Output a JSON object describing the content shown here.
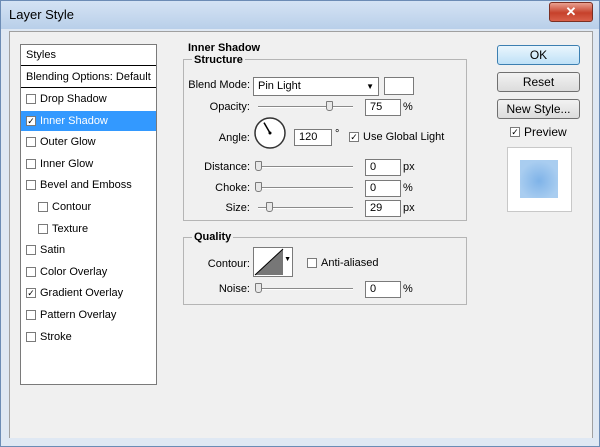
{
  "window": {
    "title": "Layer Style",
    "close_label": "✕"
  },
  "styles_panel": {
    "header": "Styles",
    "blending": "Blending Options: Default",
    "items": [
      {
        "label": "Drop Shadow",
        "checked": false,
        "selected": false,
        "indent": false
      },
      {
        "label": "Inner Shadow",
        "checked": true,
        "selected": true,
        "indent": false
      },
      {
        "label": "Outer Glow",
        "checked": false,
        "selected": false,
        "indent": false
      },
      {
        "label": "Inner Glow",
        "checked": false,
        "selected": false,
        "indent": false
      },
      {
        "label": "Bevel and Emboss",
        "checked": false,
        "selected": false,
        "indent": false
      },
      {
        "label": "Contour",
        "checked": false,
        "selected": false,
        "indent": true
      },
      {
        "label": "Texture",
        "checked": false,
        "selected": false,
        "indent": true
      },
      {
        "label": "Satin",
        "checked": false,
        "selected": false,
        "indent": false
      },
      {
        "label": "Color Overlay",
        "checked": false,
        "selected": false,
        "indent": false
      },
      {
        "label": "Gradient Overlay",
        "checked": true,
        "selected": false,
        "indent": false
      },
      {
        "label": "Pattern Overlay",
        "checked": false,
        "selected": false,
        "indent": false
      },
      {
        "label": "Stroke",
        "checked": false,
        "selected": false,
        "indent": false
      }
    ]
  },
  "inner_shadow": {
    "title": "Inner Shadow",
    "structure": {
      "title": "Structure",
      "blend_mode_label": "Blend Mode:",
      "blend_mode_value": "Pin Light",
      "shadow_color": "#ffffff",
      "opacity_label": "Opacity:",
      "opacity_value": "75",
      "opacity_unit": "%",
      "opacity_fraction": 0.75,
      "angle_label": "Angle:",
      "angle_value": "120",
      "angle_unit": "°",
      "global_light_label": "Use Global Light",
      "global_light_checked": true,
      "distance_label": "Distance:",
      "distance_value": "0",
      "distance_unit": "px",
      "distance_fraction": 0,
      "choke_label": "Choke:",
      "choke_value": "0",
      "choke_unit": "%",
      "choke_fraction": 0,
      "size_label": "Size:",
      "size_value": "29",
      "size_unit": "px",
      "size_fraction": 0.116
    },
    "quality": {
      "title": "Quality",
      "contour_label": "Contour:",
      "anti_aliased_label": "Anti-aliased",
      "anti_aliased_checked": false,
      "noise_label": "Noise:",
      "noise_value": "0",
      "noise_unit": "%",
      "noise_fraction": 0
    }
  },
  "buttons": {
    "ok": "OK",
    "reset": "Reset",
    "new_style": "New Style...",
    "preview_label": "Preview",
    "preview_checked": true
  },
  "colors": {
    "selection": "#3399ff",
    "preview_swatch": "#a9cdf0"
  }
}
